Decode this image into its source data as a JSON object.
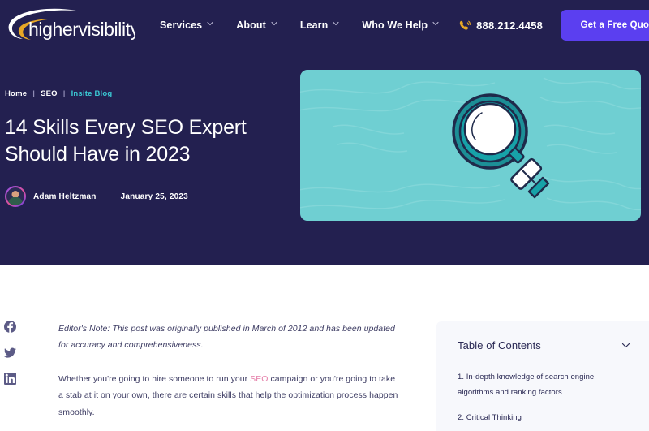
{
  "colors": {
    "navy": "#232050",
    "purple_cta": "#5B3FF0",
    "teal_hero": "#6FCFD2",
    "teal_link": "#3BC9D4",
    "pink_link": "#E57FA9",
    "body_text": "#3D3C63",
    "panel_bg": "#F7F8FC"
  },
  "header": {
    "logo_text": "highervisibility",
    "nav": [
      {
        "label": "Services",
        "has_dropdown": true
      },
      {
        "label": "About",
        "has_dropdown": true
      },
      {
        "label": "Learn",
        "has_dropdown": true
      },
      {
        "label": "Who We Help",
        "has_dropdown": true
      }
    ],
    "phone_icon": "phone-ring-icon",
    "phone": "888.212.4458",
    "cta_label": "Get a Free Quote"
  },
  "hero": {
    "breadcrumb": [
      {
        "label": "Home",
        "current": false
      },
      {
        "label": "SEO",
        "current": false
      },
      {
        "label": "Insite Blog",
        "current": true
      }
    ],
    "breadcrumb_separator": "|",
    "title": "14 Skills Every SEO Expert Should Have in 2023",
    "author": "Adam Heltzman",
    "date": "January 25, 2023",
    "avatar_icon": "author-avatar",
    "image_icon": "magnifying-glass-illustration"
  },
  "share": {
    "items": [
      {
        "icon": "facebook-icon",
        "label": "Facebook"
      },
      {
        "icon": "twitter-icon",
        "label": "Twitter"
      },
      {
        "icon": "linkedin-icon",
        "label": "LinkedIn"
      }
    ]
  },
  "article": {
    "editor_note": "Editor's Note: This post was originally published in March of 2012 and has been updated for accuracy and comprehensiveness.",
    "para1_before": "Whether you're going to hire someone to run your ",
    "para1_link": "SEO",
    "para1_after": " campaign or you're going to take a stab at it on your own, there are certain skills that help the optimization process happen smoothly."
  },
  "toc": {
    "title": "Table of Contents",
    "toggle_icon": "chevron-down-icon",
    "items": [
      "1. In-depth knowledge of search engine algorithms and ranking factors",
      "2. Critical Thinking"
    ]
  }
}
